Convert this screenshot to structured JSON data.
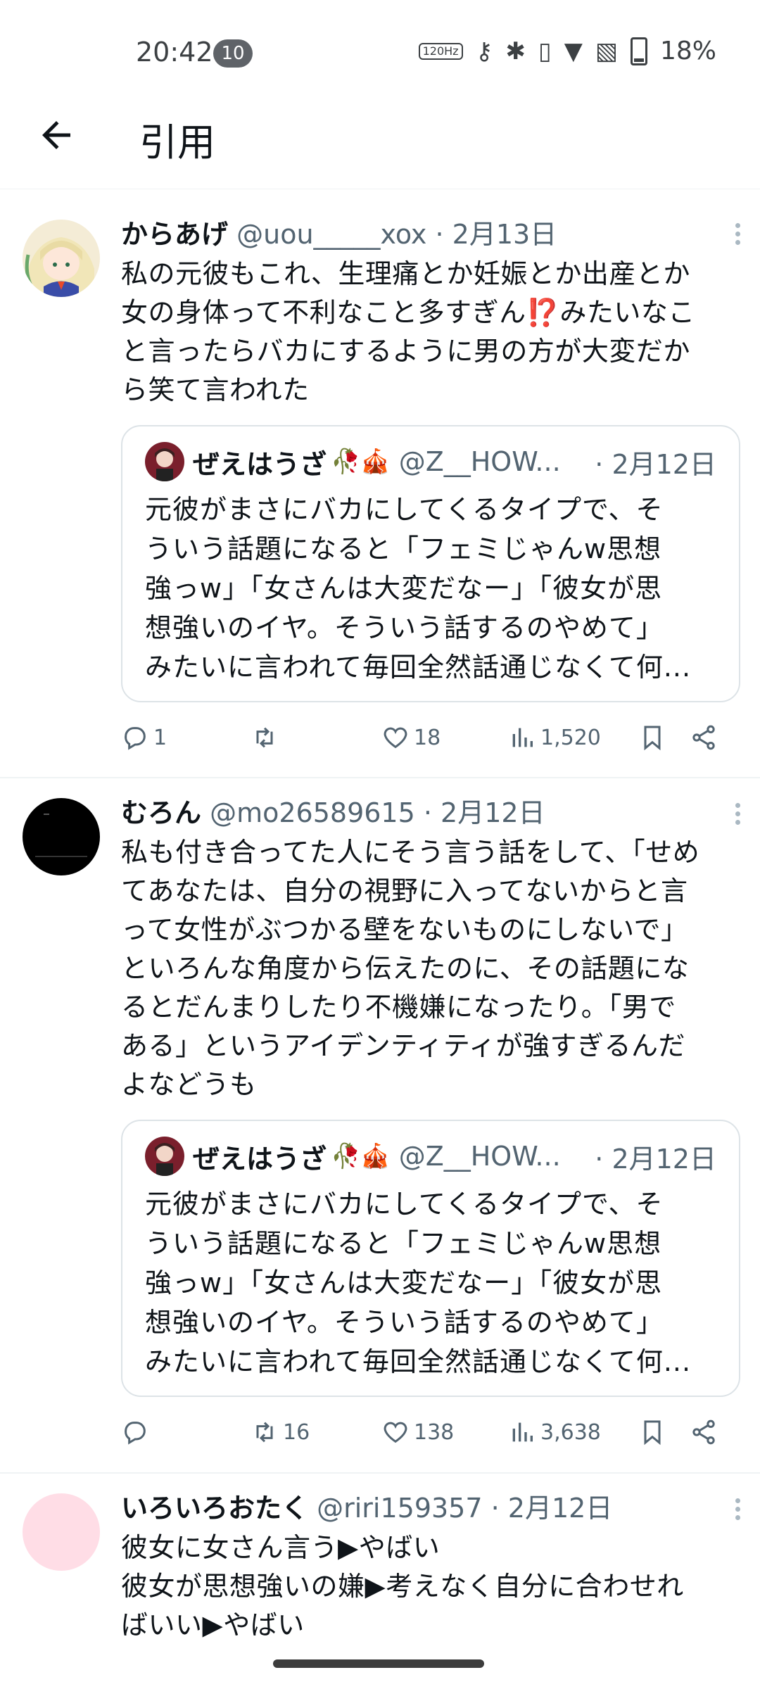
{
  "status_bar": {
    "time": "20:42",
    "notif_count": "10",
    "refresh_rate": "120Hz",
    "battery": "18%"
  },
  "header": {
    "title": "引用"
  },
  "tweets": [
    {
      "name": "からあげ",
      "handle": "@uou_____xox",
      "date": "· 2月13日",
      "text_lines": [
        "私の元彼もこれ、生理痛とか妊娠とか出産とか",
        "女の身体って不利なこと多すぎん⁉️みたいなこ",
        "と言ったらバカにするように男の方が大変だか",
        "ら笑て言われた"
      ],
      "quote": {
        "name": "ぜえはうざ",
        "emoji": "🥀🎪",
        "handle": "@Z__HOW...",
        "date": "· 2月12日",
        "text_lines": [
          "元彼がまさにバカにしてくるタイプで、そ",
          "ういう話題になると「フェミじゃんw思想",
          "強っw」「女さんは大変だなー」「彼女が思",
          "想強いのイヤ。そういう話するのやめて」",
          "みたいに言われて毎回全然話通じなくて何..."
        ]
      },
      "stats": {
        "replies": "1",
        "retweets": "",
        "likes": "18",
        "views": "1,520"
      }
    },
    {
      "name": "むろん",
      "handle": "@mo26589615",
      "date": "· 2月12日",
      "text_lines": [
        "私も付き合ってた人にそう言う話をして、「せめ",
        "てあなたは、自分の視野に入ってないからと言",
        "って女性がぶつかる壁をないものにしないで」",
        "といろんな角度から伝えたのに、その話題にな",
        "るとだんまりしたり不機嫌になったり。「男で",
        "ある」というアイデンティティが強すぎるんだ",
        "よなどうも"
      ],
      "quote": {
        "name": "ぜえはうざ",
        "emoji": "🥀🎪",
        "handle": "@Z__HOW...",
        "date": "· 2月12日",
        "text_lines": [
          "元彼がまさにバカにしてくるタイプで、そ",
          "ういう話題になると「フェミじゃんw思想",
          "強っw」「女さんは大変だなー」「彼女が思",
          "想強いのイヤ。そういう話するのやめて」",
          "みたいに言われて毎回全然話通じなくて何..."
        ]
      },
      "stats": {
        "replies": "",
        "retweets": "16",
        "likes": "138",
        "views": "3,638"
      }
    },
    {
      "name": "いろいろおたく",
      "handle": "@riri159357",
      "date": "· 2月12日",
      "text_lines": [
        "彼女に女さん言う▶やばい",
        "彼女が思想強いの嫌▶考えなく自分に合わせれ",
        "ばいい▶やばい"
      ]
    }
  ],
  "icons": {
    "back": "arrow-left-icon",
    "more": "more-vertical-icon",
    "reply": "reply-icon",
    "retweet": "retweet-icon",
    "like": "heart-icon",
    "views": "views-icon",
    "bookmark": "bookmark-icon",
    "share": "share-icon"
  },
  "colors": {
    "text": "#0f1419",
    "secondary": "#536471",
    "divider": "#eff3f4",
    "avatar3": "#ffdde6"
  }
}
